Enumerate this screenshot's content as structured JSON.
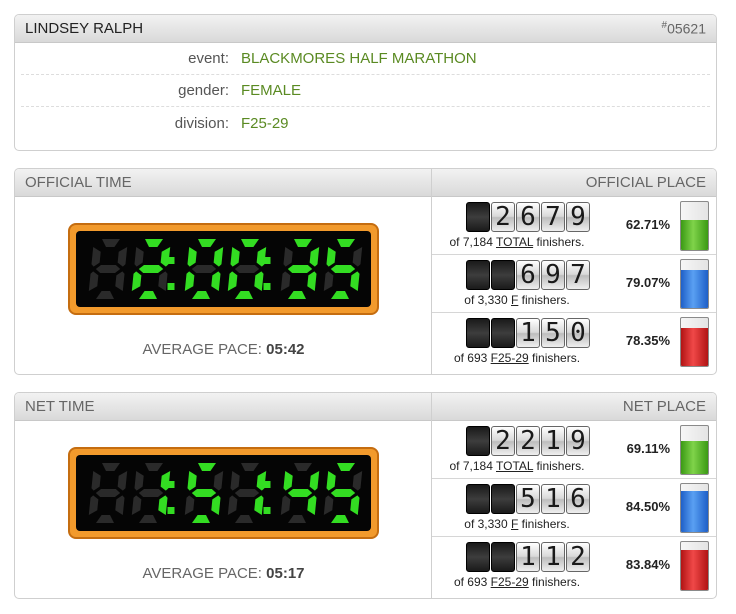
{
  "athlete": {
    "name": "LINDSEY RALPH",
    "bib_hash": "#",
    "bib": "05621",
    "fields": [
      {
        "key": "event:",
        "value": "BLACKMORES HALF MARATHON"
      },
      {
        "key": "gender:",
        "value": "FEMALE"
      },
      {
        "key": "division:",
        "value": "F25-29"
      }
    ]
  },
  "official": {
    "time_label": "OFFICIAL TIME",
    "place_label": "OFFICIAL PLACE",
    "time": "2:00:35",
    "pace_label": "AVERAGE PACE:",
    "pace": "05:42",
    "places": [
      {
        "digits": [
          "",
          "2",
          "6",
          "7",
          "9"
        ],
        "pre": "of 7,184 ",
        "cat": "TOTAL",
        "post": " finishers.",
        "pct": "62.71%",
        "fill": 0.6271,
        "color": "green"
      },
      {
        "digits": [
          "",
          "",
          "6",
          "9",
          "7"
        ],
        "pre": "of 3,330 ",
        "cat": "F",
        "post": " finishers.",
        "pct": "79.07%",
        "fill": 0.7907,
        "color": "blue"
      },
      {
        "digits": [
          "",
          "",
          "1",
          "5",
          "0"
        ],
        "pre": "of 693 ",
        "cat": "F25-29",
        "post": " finishers.",
        "pct": "78.35%",
        "fill": 0.7835,
        "color": "red"
      }
    ]
  },
  "net": {
    "time_label": "NET TIME",
    "place_label": "NET PLACE",
    "time": "1:51:45",
    "pace_label": "AVERAGE PACE:",
    "pace": "05:17",
    "places": [
      {
        "digits": [
          "",
          "2",
          "2",
          "1",
          "9"
        ],
        "pre": "of 7,184 ",
        "cat": "TOTAL",
        "post": " finishers.",
        "pct": "69.11%",
        "fill": 0.6911,
        "color": "green"
      },
      {
        "digits": [
          "",
          "",
          "5",
          "1",
          "6"
        ],
        "pre": "of 3,330 ",
        "cat": "F",
        "post": " finishers.",
        "pct": "84.50%",
        "fill": 0.845,
        "color": "blue"
      },
      {
        "digits": [
          "",
          "",
          "1",
          "1",
          "2"
        ],
        "pre": "of 693 ",
        "cat": "F25-29",
        "post": " finishers.",
        "pct": "83.84%",
        "fill": 0.8384,
        "color": "red"
      }
    ]
  },
  "colors": {
    "digit_on": "#33dd22",
    "digit_off": "#2a2a2a",
    "clock_frame": "#f29a2c",
    "value_text": "#5a8a22"
  }
}
